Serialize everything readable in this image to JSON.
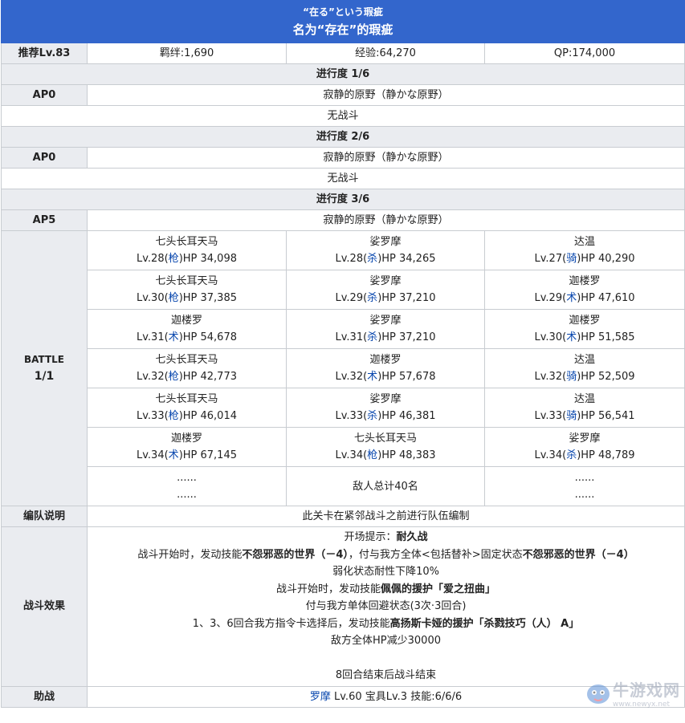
{
  "title": {
    "sub": "“在る”という瑕疵",
    "main": "名为“存在”的瑕疵"
  },
  "summary": {
    "rec_level": "推荐Lv.83",
    "bond": "羁绊:1,690",
    "exp": "经验:64,270",
    "qp": "QP:174,000"
  },
  "progress": [
    {
      "label": "进行度 1/6",
      "ap": "AP0",
      "location": "寂静的原野（静かな原野）",
      "battle": "无战斗"
    },
    {
      "label": "进行度 2/6",
      "ap": "AP0",
      "location": "寂静的原野（静かな原野）",
      "battle": "无战斗"
    },
    {
      "label": "进行度 3/6",
      "ap": "AP5",
      "location": "寂静的原野（静かな原野）"
    }
  ],
  "battle_label": [
    "BATTLE",
    "1/1"
  ],
  "enemies": [
    [
      {
        "name": "七头长耳天马",
        "lv": "Lv.28(",
        "cls": "枪",
        "hp": ")HP 34,098"
      },
      {
        "name": "娑罗摩",
        "lv": "Lv.28(",
        "cls": "杀",
        "hp": ")HP 34,265"
      },
      {
        "name": "达温",
        "lv": "Lv.27(",
        "cls": "骑",
        "hp": ")HP 40,290"
      }
    ],
    [
      {
        "name": "七头长耳天马",
        "lv": "Lv.30(",
        "cls": "枪",
        "hp": ")HP 37,385"
      },
      {
        "name": "娑罗摩",
        "lv": "Lv.29(",
        "cls": "杀",
        "hp": ")HP 37,210"
      },
      {
        "name": "迦楼罗",
        "lv": "Lv.29(",
        "cls": "术",
        "hp": ")HP 47,610"
      }
    ],
    [
      {
        "name": "迦楼罗",
        "lv": "Lv.31(",
        "cls": "术",
        "hp": ")HP 54,678"
      },
      {
        "name": "娑罗摩",
        "lv": "Lv.31(",
        "cls": "杀",
        "hp": ")HP 37,210"
      },
      {
        "name": "迦楼罗",
        "lv": "Lv.30(",
        "cls": "术",
        "hp": ")HP 51,585"
      }
    ],
    [
      {
        "name": "七头长耳天马",
        "lv": "Lv.32(",
        "cls": "枪",
        "hp": ")HP 42,773"
      },
      {
        "name": "迦楼罗",
        "lv": "Lv.32(",
        "cls": "术",
        "hp": ")HP 57,678"
      },
      {
        "name": "达温",
        "lv": "Lv.32(",
        "cls": "骑",
        "hp": ")HP 52,509"
      }
    ],
    [
      {
        "name": "七头长耳天马",
        "lv": "Lv.33(",
        "cls": "枪",
        "hp": ")HP 46,014"
      },
      {
        "name": "娑罗摩",
        "lv": "Lv.33(",
        "cls": "杀",
        "hp": ")HP 46,381"
      },
      {
        "name": "达温",
        "lv": "Lv.33(",
        "cls": "骑",
        "hp": ")HP 56,541"
      }
    ],
    [
      {
        "name": "迦楼罗",
        "lv": "Lv.34(",
        "cls": "术",
        "hp": ")HP 67,145"
      },
      {
        "name": "七头长耳天马",
        "lv": "Lv.34(",
        "cls": "枪",
        "hp": ")HP 48,383"
      },
      {
        "name": "娑罗摩",
        "lv": "Lv.34(",
        "cls": "杀",
        "hp": ")HP 48,789"
      }
    ]
  ],
  "enemies_more": {
    "left": [
      "......",
      "......"
    ],
    "mid": "敌人总计40名",
    "right": [
      "......",
      "......"
    ]
  },
  "formation": {
    "label": "编队说明",
    "text": "此关卡在紧邻战斗之前进行队伍编制"
  },
  "effects": {
    "label": "战斗效果",
    "l1a": "开场提示：",
    "l1b": "耐久战",
    "l2a": "战斗开始时，发动技能",
    "l2b": "不怨邪恶的世界（－4）",
    "l2c": "，付与我方全体<包括替补>固定状态",
    "l2d": "不怨邪恶的世界（－4）",
    "l3": "弱化状态耐性下降10%",
    "l4a": "战斗开始时，发动技能",
    "l4b": "佩佩的援护「爱之扭曲」",
    "l5": "付与我方单体回避状态(3次·3回合)",
    "l6a": "1、3、6回合我方指令卡选择后，发动技能",
    "l6b": "高扬斯卡娅的援护「杀戮技巧（人） A」",
    "l7": "敌方全体HP减少30000",
    "l8": "8回合结束后战斗结束"
  },
  "support": {
    "label": "助战",
    "servant": "罗摩",
    "detail": " Lv.60 宝具Lv.3 技能:6/6/6"
  },
  "watermark": {
    "text": "牛游戏网",
    "url": "www.newyx.net"
  }
}
